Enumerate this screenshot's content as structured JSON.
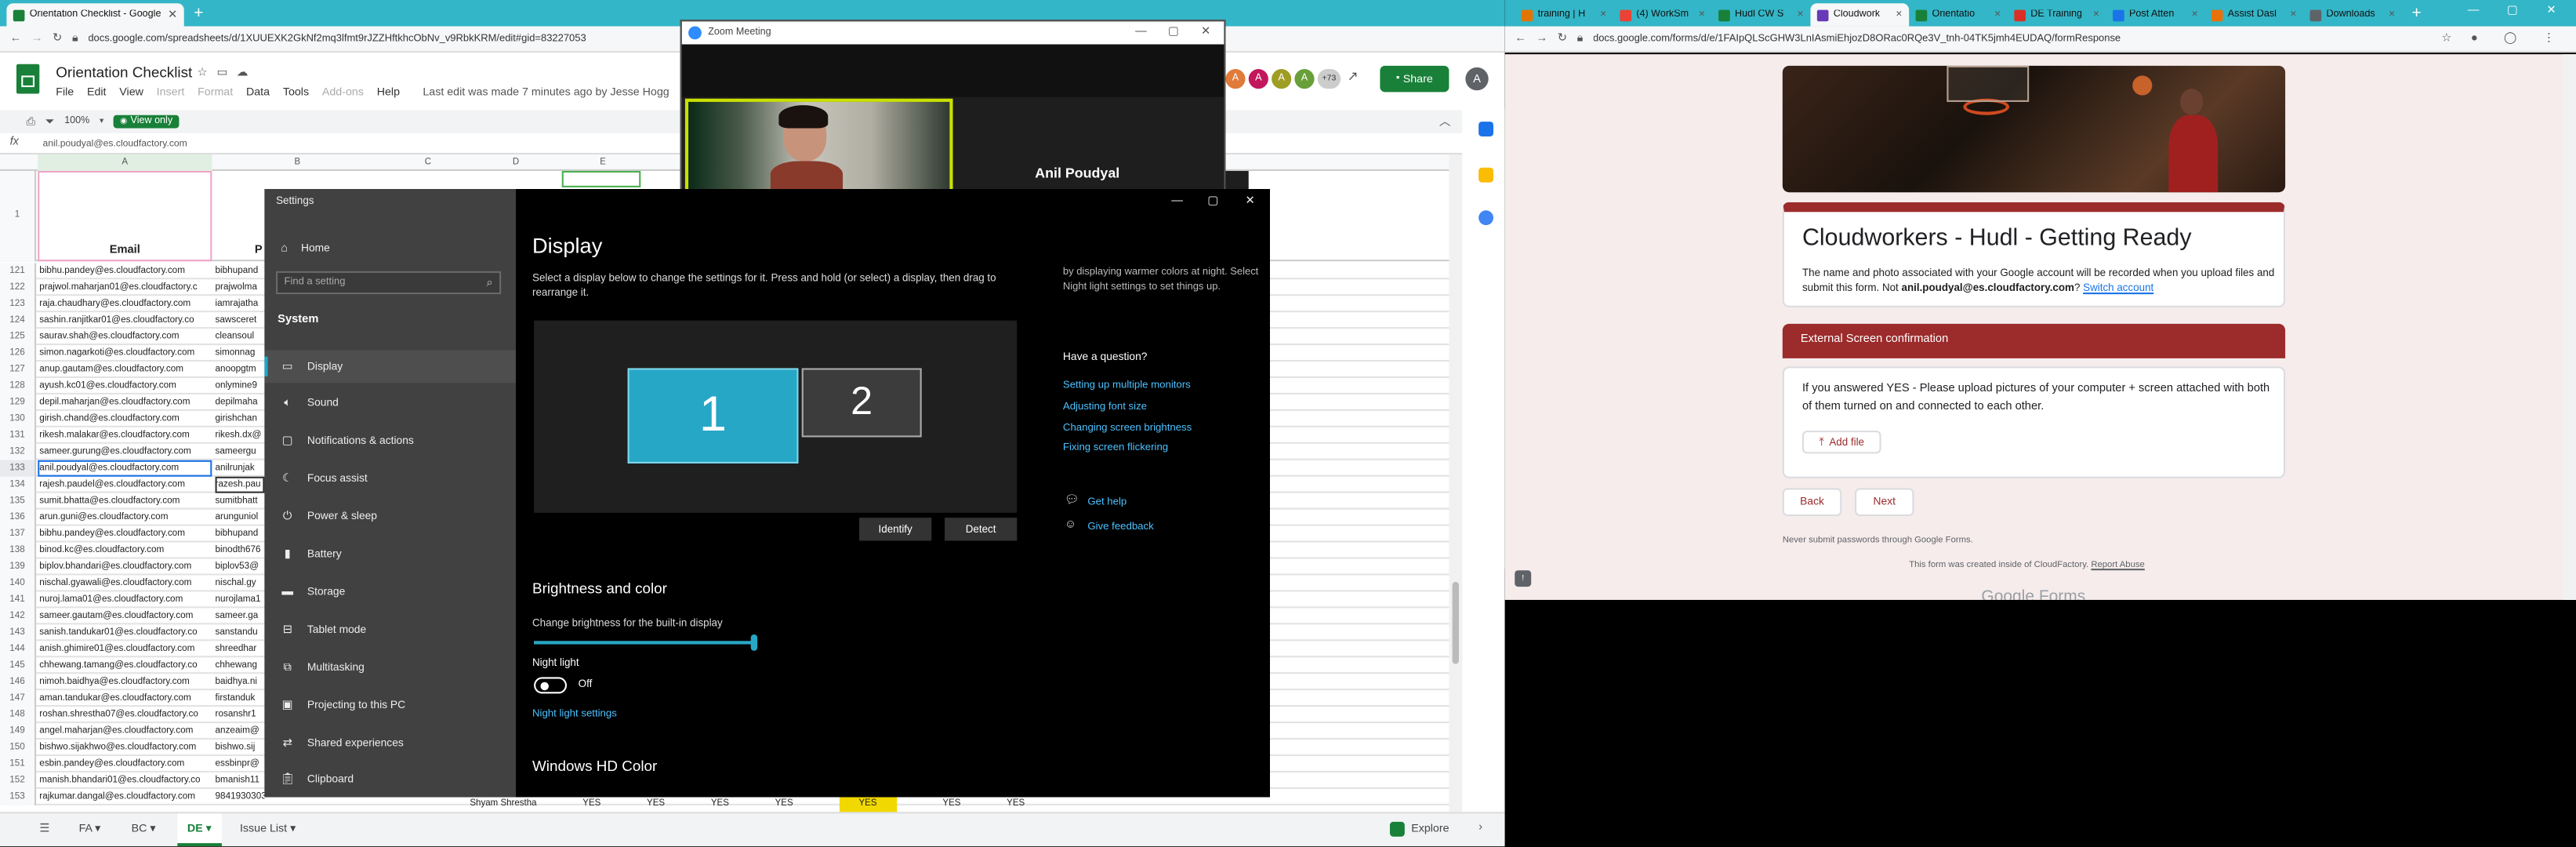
{
  "left_browser": {
    "tabs": [
      {
        "label": "Orientation Checklist - Google Sh",
        "active": true
      }
    ],
    "url": "docs.google.com/spreadsheets/d/1XUUEXK2GkNf2mq3lfmt9rJZZHftkhcObNv_v9RbkKRM/edit#gid=83227053"
  },
  "sheets": {
    "title": "Orientation Checklist",
    "menu": [
      "File",
      "Edit",
      "View",
      "Insert",
      "Format",
      "Data",
      "Tools",
      "Add-ons",
      "Help"
    ],
    "last_edit": "Last edit was made 7 minutes ago by Jesse Hogg",
    "zoom": "100%",
    "view_only": "View only",
    "share": "Share",
    "avatars": [
      "A",
      "A",
      "A",
      "A"
    ],
    "more_avatars": "+73",
    "profile": "A",
    "cell_ref": "anil.poudyal@es.cloudfactory.com",
    "columns": [
      "A",
      "B",
      "C",
      "D",
      "E"
    ],
    "header_row_num": "1",
    "header_email": "Email",
    "header_p": "P",
    "rows": [
      {
        "n": "121",
        "a": "bibhu.pandey@es.cloudfactory.com",
        "b": "bibhupand"
      },
      {
        "n": "122",
        "a": "prajwol.maharjan01@es.cloudfactory.c",
        "b": "prajwolma"
      },
      {
        "n": "123",
        "a": "raja.chaudhary@es.cloudfactory.com",
        "b": "iamrajatha"
      },
      {
        "n": "124",
        "a": "sashin.ranjitkar01@es.cloudfactory.co",
        "b": "sawsceret"
      },
      {
        "n": "125",
        "a": "saurav.shah@es.cloudfactory.com",
        "b": "cleansoul"
      },
      {
        "n": "126",
        "a": "simon.nagarkoti@es.cloudfactory.com",
        "b": "simonnag"
      },
      {
        "n": "127",
        "a": "anup.gautam@es.cloudfactory.com",
        "b": "anoopgtm"
      },
      {
        "n": "128",
        "a": "ayush.kc01@es.cloudfactory.com",
        "b": "onlymine9"
      },
      {
        "n": "129",
        "a": "depil.maharjan@es.cloudfactory.com",
        "b": "depilmaha"
      },
      {
        "n": "130",
        "a": "girish.chand@es.cloudfactory.com",
        "b": "girishchan"
      },
      {
        "n": "131",
        "a": "rikesh.malakar@es.cloudfactory.com",
        "b": "rikesh.dx@"
      },
      {
        "n": "132",
        "a": "sameer.gurung@es.cloudfactory.com",
        "b": "sameergu"
      },
      {
        "n": "133",
        "a": "anil.poudyal@es.cloudfactory.com",
        "b": "anilrunjak",
        "selected": true
      },
      {
        "n": "134",
        "a": "rajesh.paudel@es.cloudfactory.com",
        "b": "razesh.pau"
      },
      {
        "n": "135",
        "a": "sumit.bhatta@es.cloudfactory.com",
        "b": "sumitbhatt"
      },
      {
        "n": "136",
        "a": "arun.guni@es.cloudfactory.com",
        "b": "arunguniol"
      },
      {
        "n": "137",
        "a": "bibhu.pandey@es.cloudfactory.com",
        "b": "bibhupand"
      },
      {
        "n": "138",
        "a": "binod.kc@es.cloudfactory.com",
        "b": "binodth676"
      },
      {
        "n": "139",
        "a": "biplov.bhandari@es.cloudfactory.com",
        "b": "biplov53@"
      },
      {
        "n": "140",
        "a": "nischal.gyawali@es.cloudfactory.com",
        "b": "nischal.gy"
      },
      {
        "n": "141",
        "a": "nuroj.lama01@es.cloudfactory.com",
        "b": "nurojlama1"
      },
      {
        "n": "142",
        "a": "sameer.gautam@es.cloudfactory.com",
        "b": "sameer.ga"
      },
      {
        "n": "143",
        "a": "sanish.tandukar01@es.cloudfactory.co",
        "b": "sanstandu"
      },
      {
        "n": "144",
        "a": "anish.ghimire01@es.cloudfactory.com",
        "b": "shreedhar"
      },
      {
        "n": "145",
        "a": "chhewang.tamang@es.cloudfactory.co",
        "b": "chhewang"
      },
      {
        "n": "146",
        "a": "nimoh.baidhya@es.cloudfactory.com",
        "b": "baidhya.ni"
      },
      {
        "n": "147",
        "a": "aman.tandukar@es.cloudfactory.com",
        "b": "firstanduk"
      },
      {
        "n": "148",
        "a": "roshan.shrestha07@es.cloudfactory.co",
        "b": "rosanshr1"
      },
      {
        "n": "149",
        "a": "angel.maharjan@es.cloudfactory.com",
        "b": "anzeaim@"
      },
      {
        "n": "150",
        "a": "bishwo.sijakhwo@es.cloudfactory.com",
        "b": "bishwo.sij"
      },
      {
        "n": "151",
        "a": "esbin.pandey@es.cloudfactory.com",
        "b": "essbinpr@"
      },
      {
        "n": "152",
        "a": "manish.bhandari01@es.cloudfactory.co",
        "b": "bmanish11"
      },
      {
        "n": "153",
        "a": "rajkumar.dangal@es.cloudfactory.com",
        "b": "98419303031"
      }
    ],
    "last_row_extra": [
      "Shyam Shrestha",
      "YES",
      "YES",
      "YES",
      "YES",
      "YES",
      "YES",
      "YES"
    ],
    "sheet_tabs": [
      "FA",
      "BC",
      "DE",
      "Issue List"
    ],
    "active_sheet": "DE",
    "explore": "Explore"
  },
  "zoom": {
    "title": "Zoom Meeting",
    "participant": "Anil Poudyal"
  },
  "settings": {
    "title": "Settings",
    "home": "Home",
    "search_placeholder": "Find a setting",
    "section": "System",
    "nav": [
      "Display",
      "Sound",
      "Notifications & actions",
      "Focus assist",
      "Power & sleep",
      "Battery",
      "Storage",
      "Tablet mode",
      "Multitasking",
      "Projecting to this PC",
      "Shared experiences",
      "Clipboard"
    ],
    "page_title": "Display",
    "instructions": "Select a display below to change the settings for it. Press and hold (or select) a display, then drag to rearrange it.",
    "monitor1": "1",
    "monitor2": "2",
    "identify": "Identify",
    "detect": "Detect",
    "brightness_heading": "Brightness and color",
    "brightness_label": "Change brightness for the built-in display",
    "brightness_value": 1.0,
    "night_light_label": "Night light",
    "night_light_state": "Off",
    "night_light_settings": "Night light settings",
    "hd_color": "Windows HD Color",
    "side_note": "by displaying warmer colors at night. Select Night light settings to set things up.",
    "question": "Have a question?",
    "help_links": [
      "Setting up multiple monitors",
      "Adjusting font size",
      "Changing screen brightness",
      "Fixing screen flickering"
    ],
    "get_help": "Get help",
    "give_feedback": "Give feedback"
  },
  "right_browser": {
    "tabs": [
      "training | H",
      "(4) WorkSm",
      "Hudl CW S",
      "Cloudwork",
      "Orientatio",
      "DE Training",
      "Post Atten",
      "Assist Dasl",
      "Downloads"
    ],
    "active_tab": 3,
    "url": "docs.google.com/forms/d/e/1FAIpQLScGHW3LnIAsmiEhjozD8ORac0RQe3V_tnh-04TK5jmh4EUDAQ/formResponse"
  },
  "form": {
    "title": "Cloudworkers - Hudl - Getting Ready",
    "desc1": "The name and photo associated with your Google account will be recorded when you upload files and submit this form. Not ",
    "email": "anil.poudyal@es.cloudfactory.com",
    "desc2": "?",
    "switch": "Switch account",
    "section_title": "External Screen confirmation",
    "question": "If you answered YES - Please upload pictures of your computer + screen attached with both of them turned on and connected to each other.",
    "add_file": "Add file",
    "back": "Back",
    "next": "Next",
    "never_submit": "Never submit passwords through Google Forms.",
    "created_note": "This form was created inside of CloudFactory.",
    "report": "Report Abuse",
    "footer_logo": "Google Forms"
  },
  "colors": {
    "chrome_teal": "#33b6c7",
    "sheets_green": "#188038",
    "form_accent": "#9c2b2b",
    "win_accent": "#1aa9c9"
  }
}
